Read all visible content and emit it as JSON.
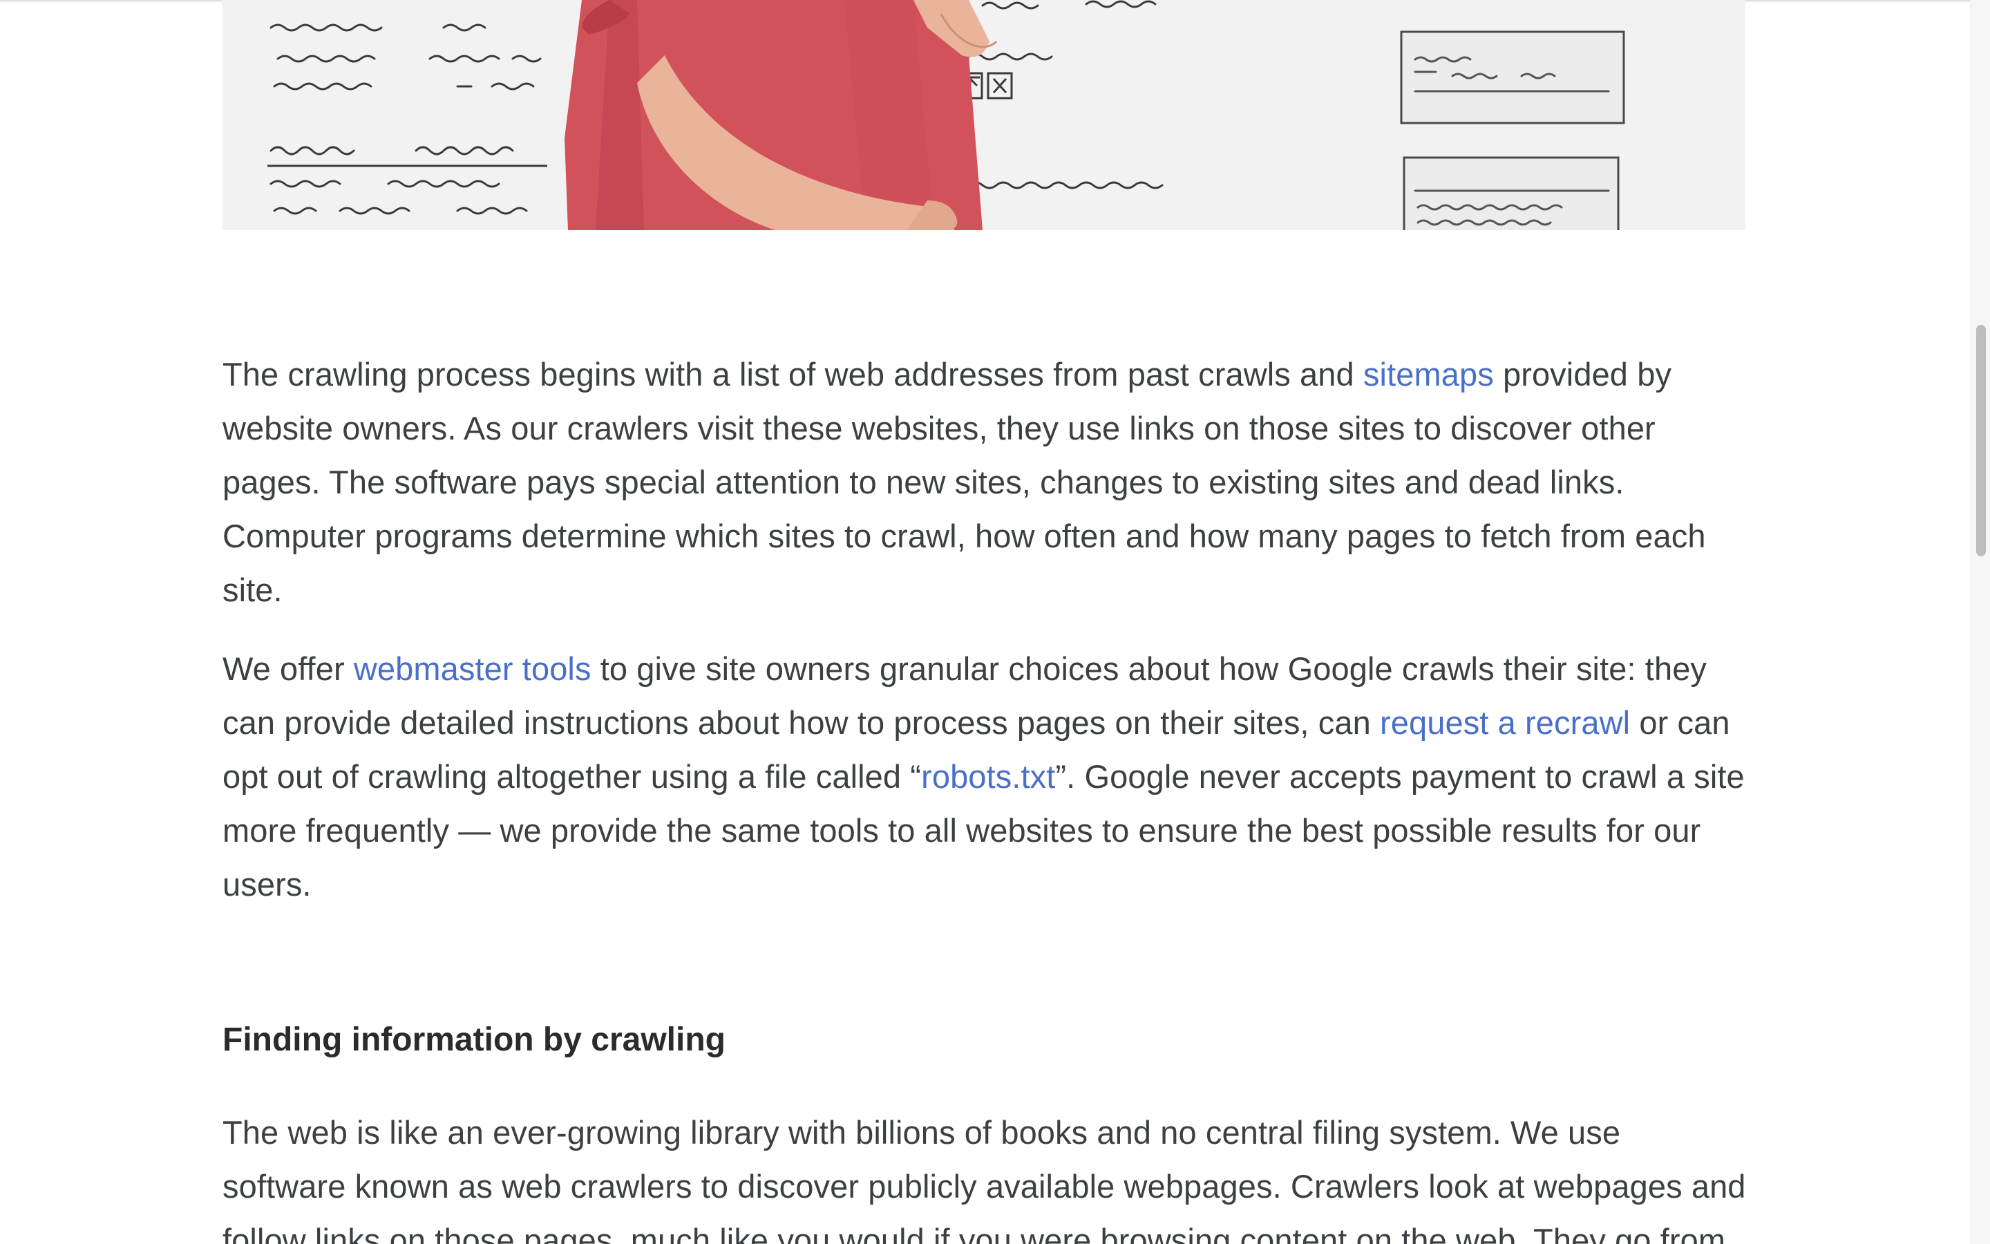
{
  "article": {
    "p1": {
      "t1": "The crawling process begins with a list of web addresses from past crawls and ",
      "link_sitemaps": "sitemaps",
      "t2": " provided by website owners. As our crawlers visit these websites, they use links on those sites to discover other pages. The software pays special attention to new sites, changes to existing sites and dead links. Computer programs determine which sites to crawl, how often and how many pages to fetch from each site."
    },
    "p2": {
      "t1": "We offer ",
      "link_webmaster_tools": "webmaster tools",
      "t2": " to give site owners granular choices about how Google crawls their site: they can provide detailed instructions about how to process pages on their sites, can ",
      "link_request_recrawl": "request a recrawl",
      "t3": " or can opt out of crawling altogether using a file called “",
      "link_robots": "robots.txt",
      "t4": "”. Google never accepts payment to crawl a site more frequently — we provide the same tools to all websites to ensure the best possible results for our users."
    },
    "heading": "Finding information by crawling",
    "p3": "The web is like an ever-growing library with billions of books and no central filing system. We use software known as web crawlers to discover publicly available webpages. Crawlers look at webpages and follow links on those pages, much like you would if you were browsing content on the web. They go from"
  },
  "colors": {
    "link": "#4a6fc9",
    "body_text": "#3c4043",
    "heading": "#2b2b2b",
    "shirt": "#d2525c"
  }
}
